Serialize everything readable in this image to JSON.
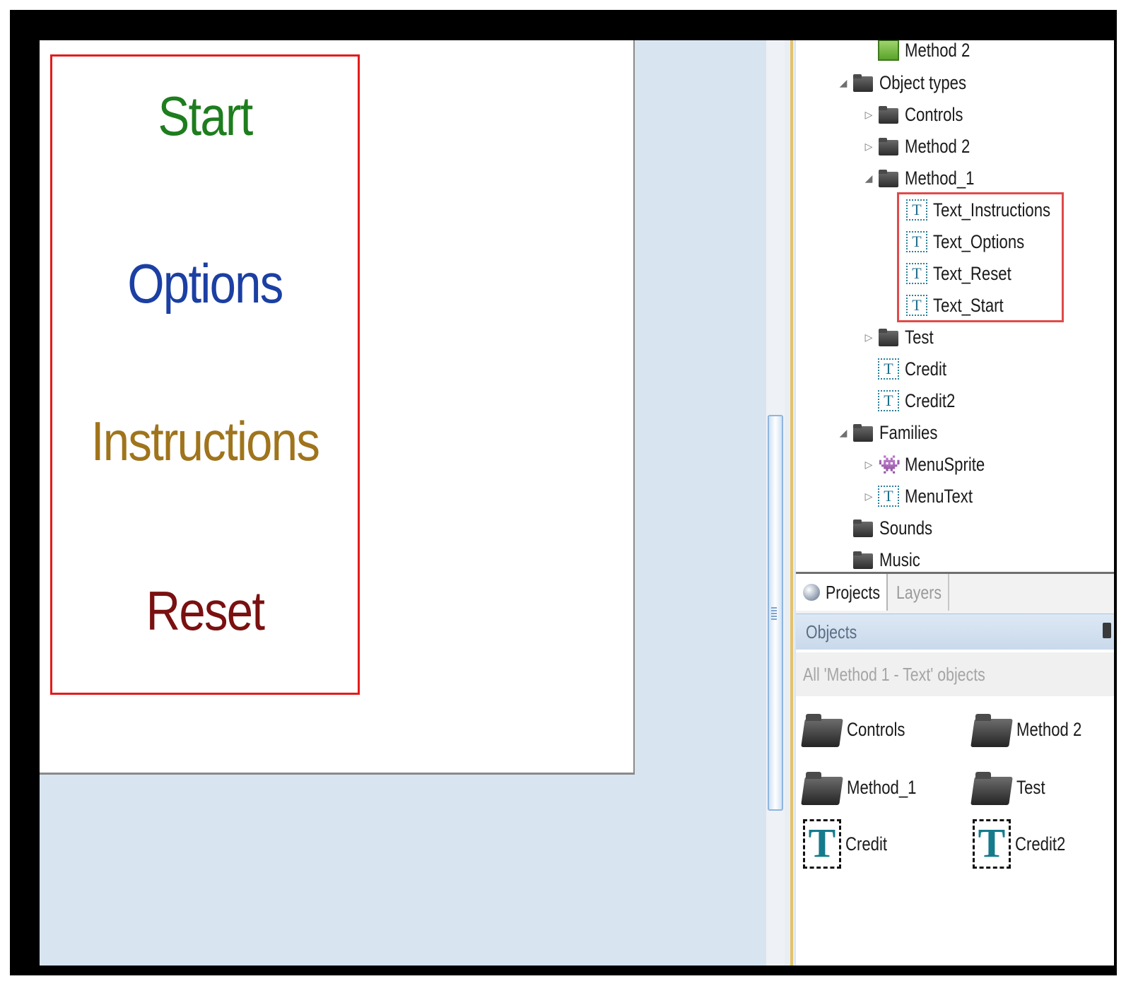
{
  "canvas": {
    "menu_items": [
      {
        "label": "Start",
        "color": "#1e7d1e"
      },
      {
        "label": "Options",
        "color": "#1b3fa3"
      },
      {
        "label": "Instructions",
        "color": "#a0741c"
      },
      {
        "label": "Reset",
        "color": "#7a1010"
      }
    ],
    "highlight_color": "#e41b1b"
  },
  "tree": {
    "method2_sheet": "Method 2",
    "object_types": "Object types",
    "controls": "Controls",
    "method2_folder": "Method 2",
    "method1_folder": "Method_1",
    "text_instructions": "Text_Instructions",
    "text_options": "Text_Options",
    "text_reset": "Text_Reset",
    "text_start": "Text_Start",
    "test": "Test",
    "credit": "Credit",
    "credit2": "Credit2",
    "families": "Families",
    "menusprite": "MenuSprite",
    "menutext": "MenuText",
    "sounds": "Sounds",
    "music": "Music"
  },
  "tabs": {
    "projects": "Projects",
    "layers": "Layers"
  },
  "objects_panel": {
    "title": "Objects",
    "filter": "All 'Method 1 - Text' objects",
    "items": {
      "controls": "Controls",
      "method2": "Method 2",
      "method1": "Method_1",
      "test": "Test",
      "credit": "Credit",
      "credit2": "Credit2"
    }
  }
}
